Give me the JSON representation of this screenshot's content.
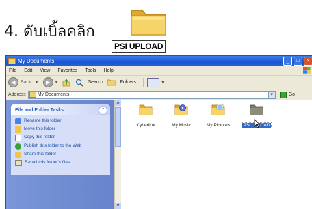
{
  "instruction": {
    "step_text": "4. ดับเบิ้ลคลิก"
  },
  "highlight": {
    "folder_label": "PSI UPLOAD"
  },
  "window": {
    "title": "My Documents",
    "menu": [
      "File",
      "Edit",
      "View",
      "Favorites",
      "Tools",
      "Help"
    ],
    "toolbar": {
      "back": "Back",
      "search": "Search",
      "folders": "Folders"
    },
    "address": {
      "label": "Address",
      "value": "My Documents",
      "go": "Go"
    },
    "task_pane": {
      "title": "File and Folder Tasks",
      "items": [
        "Rename this folder",
        "Move this folder",
        "Copy this folder",
        "Publish this folder to the Web",
        "Share this folder",
        "E-mail this folder's files"
      ]
    },
    "folders": [
      "Cyberlink",
      "My Music",
      "My Pictures",
      "PSI UPLOAD"
    ]
  },
  "colors": {
    "titlebar": "#1a55d6",
    "task_pane_bg": "#6783cc",
    "selection": "#316ac5",
    "folder_yellow": "#f3d16a"
  }
}
